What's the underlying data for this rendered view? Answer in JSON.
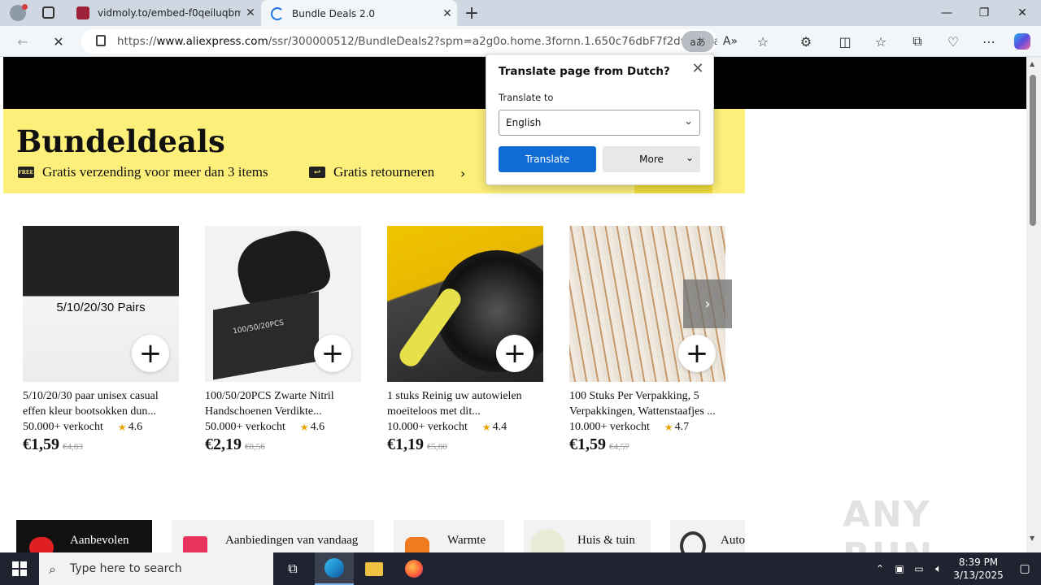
{
  "browser": {
    "tabs": [
      {
        "title": "vidmoly.to/embed-f0qeiluqbm5l",
        "active": false
      },
      {
        "title": "Bundle Deals 2.0",
        "active": true
      }
    ],
    "new_tab_symbol": "+",
    "address": {
      "prefix": "https://",
      "domain": "www.aliexpress.com",
      "path": "/ssr/300000512/BundleDeals2?spm=a2g0o.home.3fornn.1.650c76dbF7f2dw&disab..."
    },
    "translate_icon_text": "aあ",
    "icons": [
      "back-icon",
      "refresh-stop-icon",
      "lock-icon",
      "read-aloud-icon",
      "favorite-star-icon",
      "extensions-icon",
      "split-screen-icon",
      "favorites-icon",
      "collections-icon",
      "performance-icon",
      "more-icon",
      "copilot-icon"
    ]
  },
  "translate_popup": {
    "title": "Translate page from Dutch?",
    "translate_to_label": "Translate to",
    "selected_language": "English",
    "translate_button": "Translate",
    "more_button": "More"
  },
  "page": {
    "title": "Bundeldeals",
    "perks": [
      {
        "badge": "FREE",
        "text": "Gratis verzending voor meer dan 3 items"
      },
      {
        "badge": "↩",
        "text": "Gratis retourneren"
      }
    ],
    "products": [
      {
        "name": "5/10/20/30 paar unisex casual effen kleur bootsokken dun...",
        "sold": "50.000+ verkocht",
        "rating": "4.6",
        "price": "€1,59",
        "old_price": "€4,83",
        "image_text": "5/10/20/30 Pairs"
      },
      {
        "name": "100/50/20PCS Zwarte Nitril Handschoenen Verdikte...",
        "sold": "50.000+ verkocht",
        "rating": "4.6",
        "price": "€2,19",
        "old_price": "€8,56",
        "image_text": "100/50/20PCS"
      },
      {
        "name": "1 stuks Reinig uw autowielen moeiteloos met dit...",
        "sold": "10.000+ verkocht",
        "rating": "4.4",
        "price": "€1,19",
        "old_price": "€5,80",
        "image_text": ""
      },
      {
        "name": "100 Stuks Per Verpakking, 5 Verpakkingen, Wattenstaafjes ...",
        "sold": "10.000+ verkocht",
        "rating": "4.7",
        "price": "€1,59",
        "old_price": "€4,57",
        "image_text": ""
      }
    ],
    "categories": [
      "Aanbevolen",
      "Aanbiedingen van vandaag",
      "Warmte",
      "Huis & tuin",
      "Auto"
    ]
  },
  "watermark": "ANY RUN",
  "taskbar": {
    "search_placeholder": "Type here to search",
    "time": "8:39 PM",
    "date": "3/13/2025"
  },
  "colors": {
    "banner_yellow": "#fdf07a",
    "accent_blue": "#0f6cd6",
    "star": "#e8a400"
  }
}
